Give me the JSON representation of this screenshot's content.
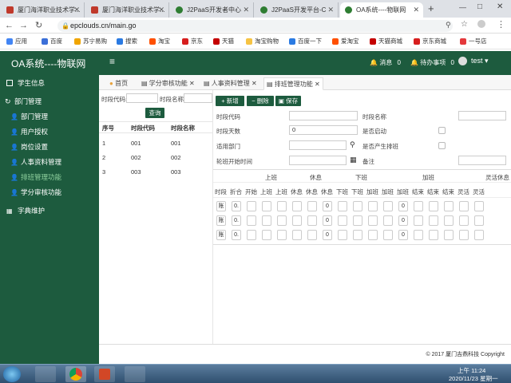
{
  "browser": {
    "tabs": [
      {
        "label": "厦门海洋职业技术学...",
        "active": false
      },
      {
        "label": "厦门海洋职业技术学...",
        "active": false
      },
      {
        "label": "J2PaaS开发者中心",
        "active": false
      },
      {
        "label": "J2PaaS开发平台-C",
        "active": false
      },
      {
        "label": "OA系统----物联网",
        "active": true
      }
    ],
    "new_tab": "+",
    "url": "epclouds.cn/main.go",
    "bookmarks": [
      "应用",
      "百度",
      "苏宁易购",
      "搜索",
      "淘宝",
      "京东",
      "天猫",
      "淘宝购物",
      "百度一下",
      "爱淘宝",
      "天猫商城",
      "京东商城",
      "一号店"
    ]
  },
  "app": {
    "title": "OA系统----物联网",
    "menu_toggle": "≡",
    "messages_label": "消息",
    "messages_count": "0",
    "todo_label": "待办事项",
    "todo_count": "0",
    "user": "test"
  },
  "sidebar": {
    "items": [
      {
        "label": "学生信息",
        "level": 0,
        "active": false
      },
      {
        "label": "部门管理",
        "level": 0,
        "active": false
      },
      {
        "label": "部门管理",
        "level": 1,
        "active": false
      },
      {
        "label": "用户授权",
        "level": 1,
        "active": false
      },
      {
        "label": "岗位设置",
        "level": 1,
        "active": false
      },
      {
        "label": "人事资料管理",
        "level": 1,
        "active": false
      },
      {
        "label": "排班管理功能",
        "level": 1,
        "active": true
      },
      {
        "label": "学分审核功能",
        "level": 1,
        "active": false
      },
      {
        "label": "字典维护",
        "level": 0,
        "active": false
      }
    ]
  },
  "page_tabs": [
    {
      "label": "首页",
      "closable": false,
      "active": false
    },
    {
      "label": "学分审核功能",
      "closable": true,
      "active": false
    },
    {
      "label": "人事资料管理",
      "closable": true,
      "active": false
    },
    {
      "label": "排班管理功能",
      "closable": true,
      "active": true
    }
  ],
  "search": {
    "code_label": "时段代码:",
    "name_label": "时段名称:",
    "query_button": "查询"
  },
  "list": {
    "headers": [
      "序号",
      "时段代码",
      "时段名称"
    ],
    "rows": [
      [
        "1",
        "001",
        "001"
      ],
      [
        "2",
        "002",
        "002"
      ],
      [
        "3",
        "003",
        "003"
      ]
    ]
  },
  "toolbar": {
    "add": "新增",
    "delete": "删除",
    "save": "保存"
  },
  "form": {
    "code_label": "时段代码",
    "name_label": "时段名称",
    "days_label": "时段天数",
    "days_value": "0",
    "enabled_label": "是否启动",
    "dept_label": "适用部门",
    "auto_label": "是否产生排班",
    "start_label": "轮班开始时间",
    "remark_label": "备注"
  },
  "grid": {
    "groups": [
      "上班",
      "休息",
      "下班",
      "加班",
      "灵活休息"
    ],
    "headers": [
      "时段",
      "折合",
      "开始",
      "上班",
      "上班",
      "休息",
      "休息",
      "休息",
      "下班",
      "下班",
      "加班",
      "加班",
      "加班",
      "结束",
      "结束",
      "结束",
      "灵活",
      "灵活"
    ],
    "rows": [
      {
        "prefix": "账",
        "fold": "0.",
        "mid1": "0",
        "mid2": "0"
      },
      {
        "prefix": "账",
        "fold": "0.",
        "mid1": "0",
        "mid2": "0"
      },
      {
        "prefix": "账",
        "fold": "0.",
        "mid1": "0",
        "mid2": "0"
      }
    ]
  },
  "footer": "© 2017 厦门吉鼎科技 Copyright",
  "taskbar": {
    "time": "上午 11:24",
    "date": "2020/11/23 星期一"
  }
}
